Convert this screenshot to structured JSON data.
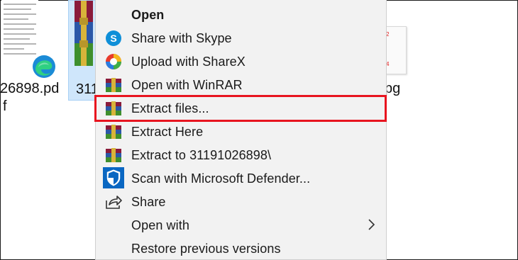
{
  "desktop": {
    "files": [
      {
        "label_line1": "26898.pd",
        "label_line2": "f",
        "icon": "edge-pdf-icon"
      },
      {
        "label_line1": "311",
        "icon": "winrar-archive-icon"
      },
      {
        "label_line1": "pg",
        "icon": "image-thumbnail-icon"
      }
    ]
  },
  "context_menu": {
    "items": [
      {
        "label": "Open",
        "icon": "none",
        "bold": true
      },
      {
        "label": "Share with Skype",
        "icon": "skype-icon"
      },
      {
        "label": "Upload with ShareX",
        "icon": "sharex-icon"
      },
      {
        "label": "Open with WinRAR",
        "icon": "winrar-icon"
      },
      {
        "label": "Extract files...",
        "icon": "winrar-icon",
        "highlighted": true
      },
      {
        "label": "Extract Here",
        "icon": "winrar-icon"
      },
      {
        "label": "Extract to 31191026898\\",
        "icon": "winrar-icon"
      },
      {
        "label": "Scan with Microsoft Defender...",
        "icon": "defender-shield-icon"
      },
      {
        "label": "Share",
        "icon": "share-icon"
      },
      {
        "label": "Open with",
        "icon": "none",
        "has_submenu": true
      },
      {
        "label": "Restore previous versions",
        "icon": "none"
      }
    ],
    "highlight_color": "#e8141f",
    "background_color": "#f2f2f2"
  }
}
